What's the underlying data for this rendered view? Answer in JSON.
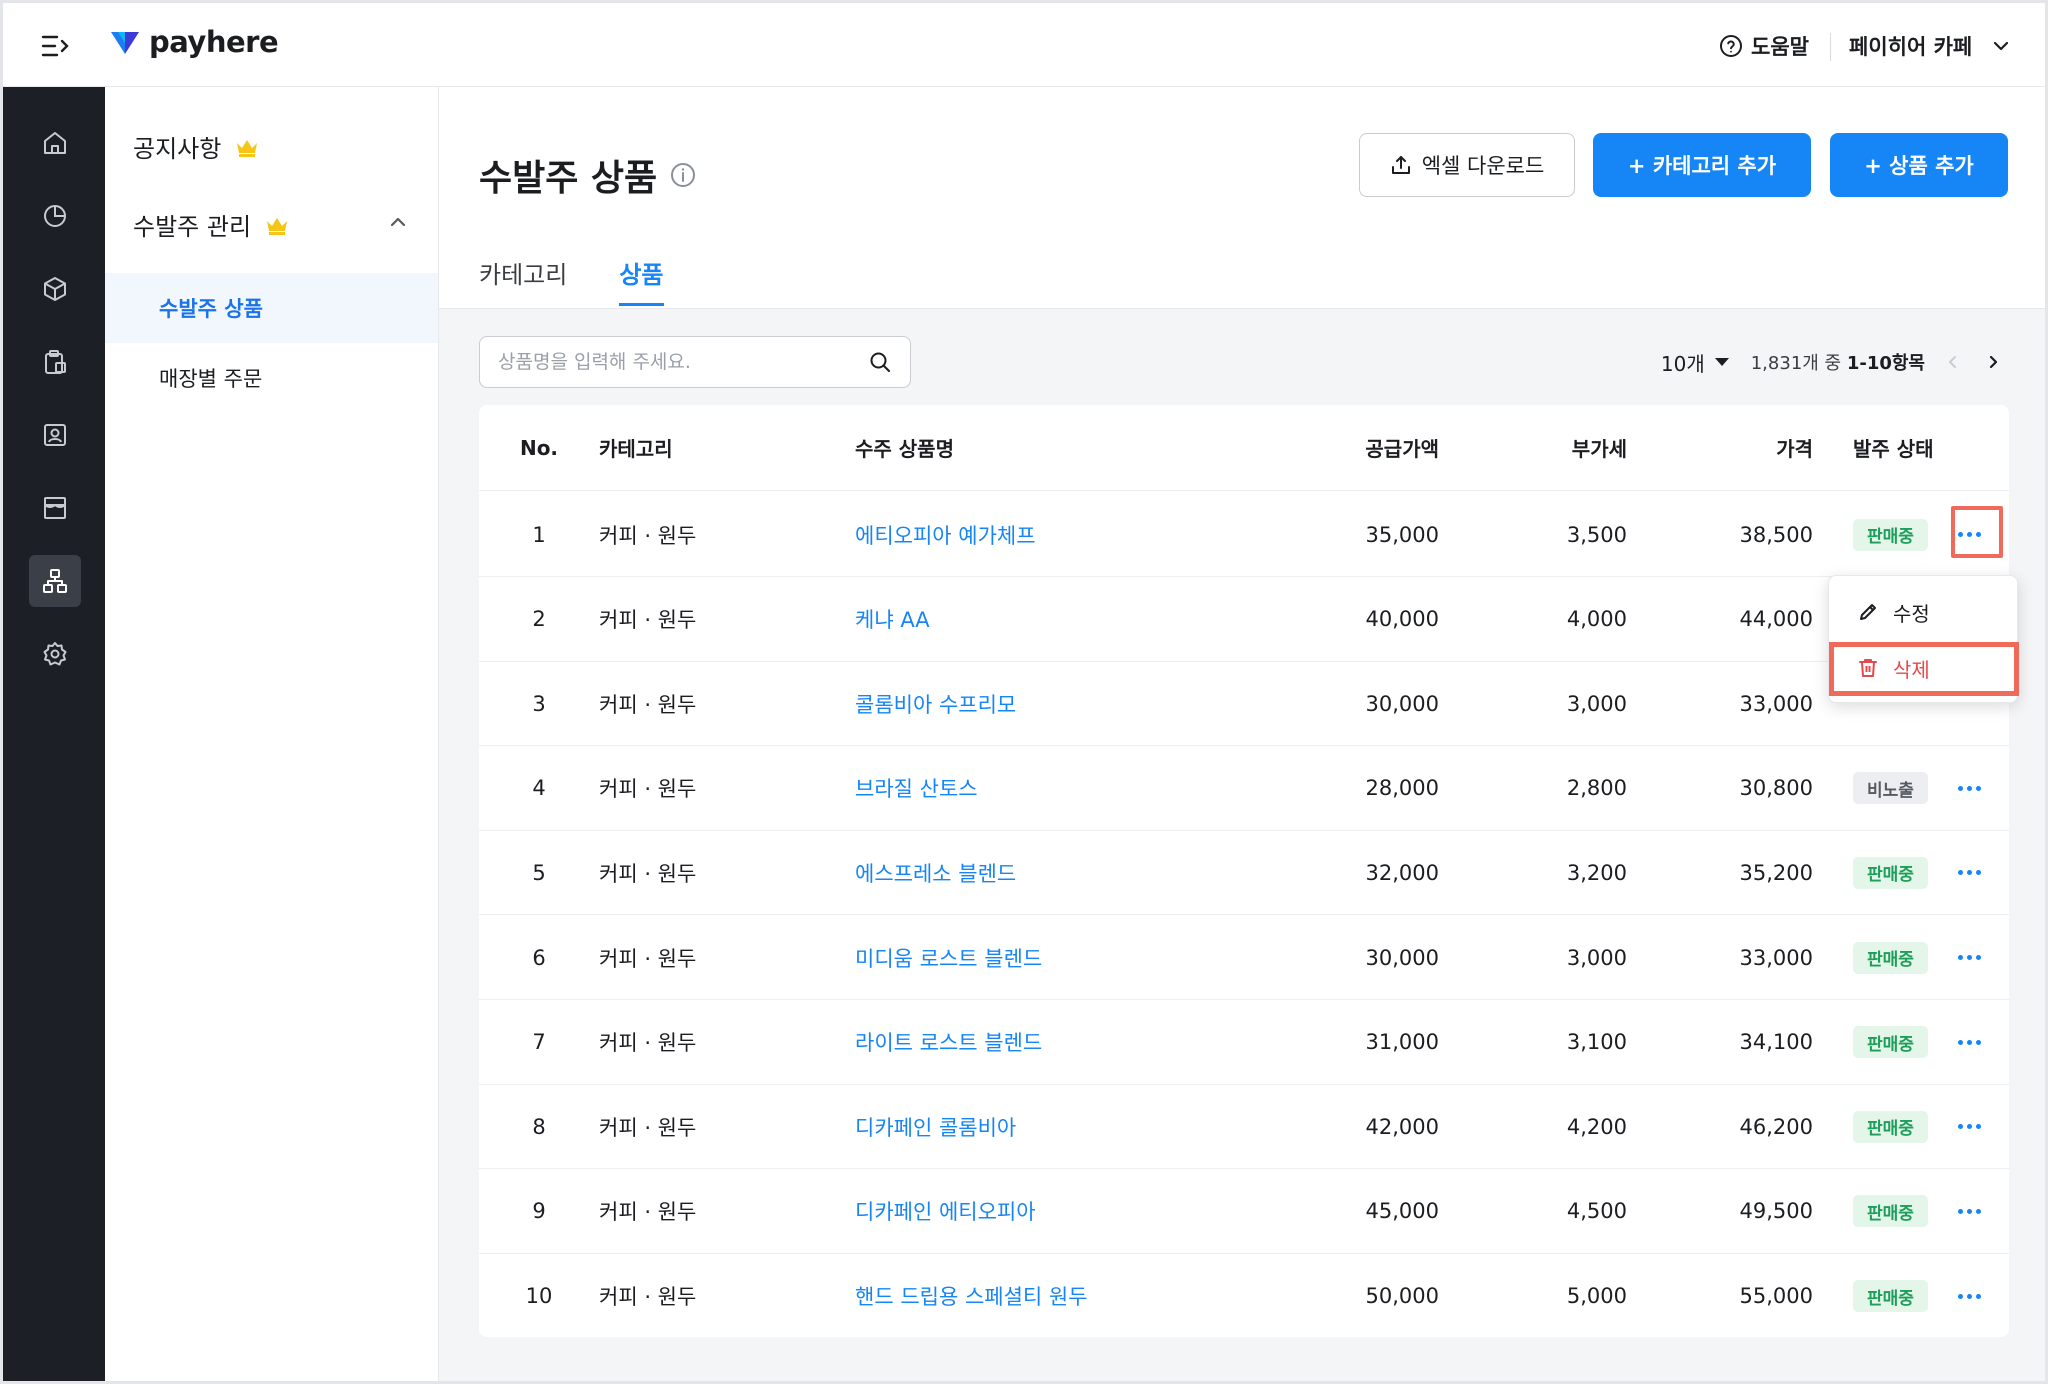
{
  "header": {
    "logo_text": "payhere",
    "help_label": "도움말",
    "store_name": "페이히어 카페"
  },
  "rail": {
    "icons": [
      "home-icon",
      "chart-pie-icon",
      "box-icon",
      "clipboard-icon",
      "user-card-icon",
      "store-icon",
      "org-chart-icon",
      "gear-icon"
    ],
    "active_index": 6
  },
  "subnav": {
    "notice_label": "공지사항",
    "group_label": "수발주 관리",
    "items": [
      {
        "label": "수발주 상품",
        "active": true
      },
      {
        "label": "매장별 주문",
        "active": false
      }
    ]
  },
  "page": {
    "title": "수발주 상품",
    "excel_button": "엑셀 다운로드",
    "add_category_button": "+ 카테고리 추가",
    "add_product_button": "+ 상품 추가",
    "tabs": [
      {
        "label": "카테고리",
        "active": false
      },
      {
        "label": "상품",
        "active": true
      }
    ]
  },
  "search": {
    "placeholder": "상품명을 입력해 주세요."
  },
  "pager": {
    "page_size": "10개",
    "range_prefix": "1,831개 중 ",
    "range_bold": "1-10항목"
  },
  "table": {
    "columns": [
      "No.",
      "카테고리",
      "수주 상품명",
      "공급가액",
      "부가세",
      "가격",
      "발주 상태"
    ],
    "rows": [
      {
        "no": "1",
        "category": "커피 · 원두",
        "name": "에티오피아 예가체프",
        "supply": "35,000",
        "vat": "3,500",
        "price": "38,500",
        "status": "판매중"
      },
      {
        "no": "2",
        "category": "커피 · 원두",
        "name": "케냐 AA",
        "supply": "40,000",
        "vat": "4,000",
        "price": "44,000",
        "status": ""
      },
      {
        "no": "3",
        "category": "커피 · 원두",
        "name": "콜롬비아 수프리모",
        "supply": "30,000",
        "vat": "3,000",
        "price": "33,000",
        "status": ""
      },
      {
        "no": "4",
        "category": "커피 · 원두",
        "name": "브라질 산토스",
        "supply": "28,000",
        "vat": "2,800",
        "price": "30,800",
        "status": "비노출"
      },
      {
        "no": "5",
        "category": "커피 · 원두",
        "name": "에스프레소 블렌드",
        "supply": "32,000",
        "vat": "3,200",
        "price": "35,200",
        "status": "판매중"
      },
      {
        "no": "6",
        "category": "커피 · 원두",
        "name": "미디움 로스트 블렌드",
        "supply": "30,000",
        "vat": "3,000",
        "price": "33,000",
        "status": "판매중"
      },
      {
        "no": "7",
        "category": "커피 · 원두",
        "name": "라이트 로스트 블렌드",
        "supply": "31,000",
        "vat": "3,100",
        "price": "34,100",
        "status": "판매중"
      },
      {
        "no": "8",
        "category": "커피 · 원두",
        "name": "디카페인 콜롬비아",
        "supply": "42,000",
        "vat": "4,200",
        "price": "46,200",
        "status": "판매중"
      },
      {
        "no": "9",
        "category": "커피 · 원두",
        "name": "디카페인 에티오피아",
        "supply": "45,000",
        "vat": "4,500",
        "price": "49,500",
        "status": "판매중"
      },
      {
        "no": "10",
        "category": "커피 · 원두",
        "name": "핸드 드립용 스페셜티 원두",
        "supply": "50,000",
        "vat": "5,000",
        "price": "55,000",
        "status": "판매중"
      }
    ]
  },
  "row_menu": {
    "edit_label": "수정",
    "delete_label": "삭제"
  },
  "colors": {
    "primary": "#1685f5",
    "rail_bg": "#1c1f25",
    "status_on_bg": "#e4f6ea",
    "status_on_text": "#1e9e5a",
    "danger": "#e5484d",
    "highlight": "#f06a5c"
  }
}
